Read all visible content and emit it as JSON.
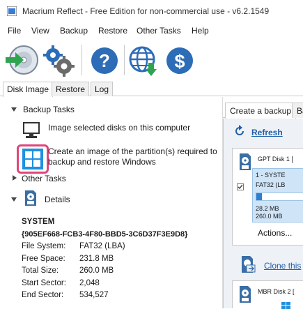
{
  "window": {
    "title": "Macrium Reflect - Free Edition for non-commercial use - v6.2.1549"
  },
  "menu": {
    "items": [
      "File",
      "View",
      "Backup",
      "Restore",
      "Other Tasks",
      "Help"
    ]
  },
  "toolbar": {
    "buttons": [
      "backup-disk-icon",
      "settings-gears-icon",
      "help-icon",
      "web-download-icon",
      "purchase-dollar-icon"
    ]
  },
  "left_tabs": [
    "Disk Image",
    "Restore",
    "Log"
  ],
  "backup_tasks": {
    "header": "Backup Tasks",
    "task1": "Image selected disks on this computer",
    "task2_line1": "Create an image of the partition(s) required to",
    "task2_line2": "backup and restore Windows"
  },
  "other_tasks": {
    "header": "Other Tasks"
  },
  "details": {
    "header": "Details",
    "name": "SYSTEM",
    "guid": "{905EF668-FCB3-4F80-BBD5-3C6D37F3E9D8}",
    "rows": [
      {
        "label": "File System:",
        "value": "FAT32 (LBA)"
      },
      {
        "label": "Free Space:",
        "value": "231.8 MB"
      },
      {
        "label": "Total Size:",
        "value": "260.0 MB"
      },
      {
        "label": "Start Sector:",
        "value": "2,048"
      },
      {
        "label": "End Sector:",
        "value": "534,527"
      }
    ]
  },
  "right_panel": {
    "tabs": [
      "Create a backup",
      "Ba"
    ],
    "refresh": "Refresh",
    "disk1": {
      "title": "GPT Disk 1 [",
      "part_name": "1 - SYSTE",
      "part_fs": "FAT32 (LB",
      "used": "28.2 MB",
      "total": "260.0 MB",
      "actions": "Actions..."
    },
    "clone": "Clone this",
    "disk2": {
      "title": "MBR Disk 2 ["
    }
  },
  "colors": {
    "accent": "#1f5fa8",
    "highlight": "#e0457b",
    "windows_blue": "#1e90e0"
  }
}
